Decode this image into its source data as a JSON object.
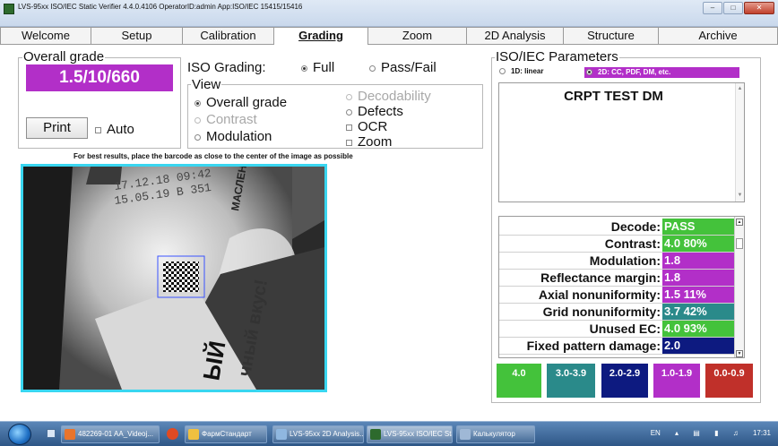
{
  "window": {
    "title": "LVS-95xx ISO/IEC Static Verifier 4.4.0.4106   OperatorID:admin   App:ISO/IEC 15415/15416"
  },
  "tabs": [
    "Welcome",
    "Setup",
    "Calibration",
    "Grading",
    "Zoom",
    "2D Analysis",
    "Structure",
    "Archive"
  ],
  "active_tab": "Grading",
  "overall_grade": {
    "legend": "Overall grade",
    "value": "1.5/10/660",
    "print_label": "Print",
    "auto_label": "Auto"
  },
  "iso_grading": {
    "label": "ISO Grading:",
    "full_label": "Full",
    "passfail_label": "Pass/Fail",
    "selected": "Full"
  },
  "view": {
    "legend": "View",
    "options": {
      "overall_grade": "Overall grade",
      "contrast": "Contrast",
      "modulation": "Modulation",
      "decodability": "Decodability",
      "defects": "Defects",
      "ocr": "OCR",
      "zoom": "Zoom"
    },
    "selected": "Overall grade"
  },
  "hint": "For best results, place the barcode as close to the center of the image as possible",
  "captured_image": {
    "print_line_1": "17.12.18 09:42",
    "print_line_2": "15.05.19 B 351",
    "side_text_1": "МАСЛЕНЕТ",
    "side_text_2": "чный вкус!",
    "side_text_3": "ЫЙ"
  },
  "iso_params": {
    "legend": "ISO/IEC Parameters",
    "symbology_1d": "1D: linear",
    "symbology_2d": "2D: CC, PDF, DM, etc.",
    "decoded_data": "CRPT TEST DM",
    "rows": [
      {
        "label": "Decode:",
        "value": "PASS",
        "color": "#44c23b"
      },
      {
        "label": "Contrast:",
        "value": "4.0  80%",
        "color": "#44c23b"
      },
      {
        "label": "Modulation:",
        "value": "1.8",
        "color": "#b22fc8"
      },
      {
        "label": "Reflectance margin:",
        "value": "1.8",
        "color": "#b22fc8"
      },
      {
        "label": "Axial nonuniformity:",
        "value": "1.5  11%",
        "color": "#b22fc8"
      },
      {
        "label": "Grid nonuniformity:",
        "value": "3.7  42%",
        "color": "#2a8a8a"
      },
      {
        "label": "Unused EC:",
        "value": "4.0  93%",
        "color": "#44c23b"
      },
      {
        "label": "Fixed pattern damage:",
        "value": "2.0",
        "color": "#0d1a80"
      }
    ]
  },
  "grade_legend": [
    {
      "label": "4.0",
      "color": "#44c23b"
    },
    {
      "label": "3.0-3.9",
      "color": "#2a8a8a"
    },
    {
      "label": "2.0-2.9",
      "color": "#0d1a80"
    },
    {
      "label": "1.0-1.9",
      "color": "#b22fc8"
    },
    {
      "label": "0.0-0.9",
      "color": "#c0302a"
    }
  ],
  "taskbar": {
    "items": [
      "482269-01 AA_Videoj...",
      "ФармСтандарт",
      "LVS-95xx 2D Analysis...",
      "LVS-95xx ISO/IEC Sta...",
      "Калькулятор"
    ],
    "lang": "EN",
    "clock": "17:31"
  }
}
